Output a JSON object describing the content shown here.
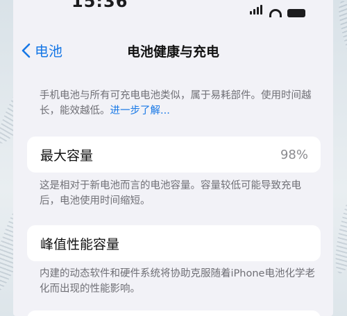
{
  "status_bar": {
    "time": "15:36"
  },
  "nav": {
    "back_label": "电池",
    "title": "电池健康与充电"
  },
  "intro": {
    "text": "手机电池与所有可充电电池类似，属于易耗部件。使用时间越长，能效越低。",
    "link": "进一步了解..."
  },
  "max_capacity": {
    "label": "最大容量",
    "value": "98%",
    "description": "这是相对于新电池而言的电池容量。容量较低可能导致充电后，电池使用时间缩短。"
  },
  "peak_performance": {
    "label": "峰值性能容量",
    "description": "内建的动态软件和硬件系统将协助克服随着iPhone电池化学老化而出现的性能影响。"
  },
  "colors": {
    "accent": "#1677e6",
    "background": "#f2f2f7",
    "card": "#ffffff",
    "secondary_text": "#6f6f75"
  }
}
